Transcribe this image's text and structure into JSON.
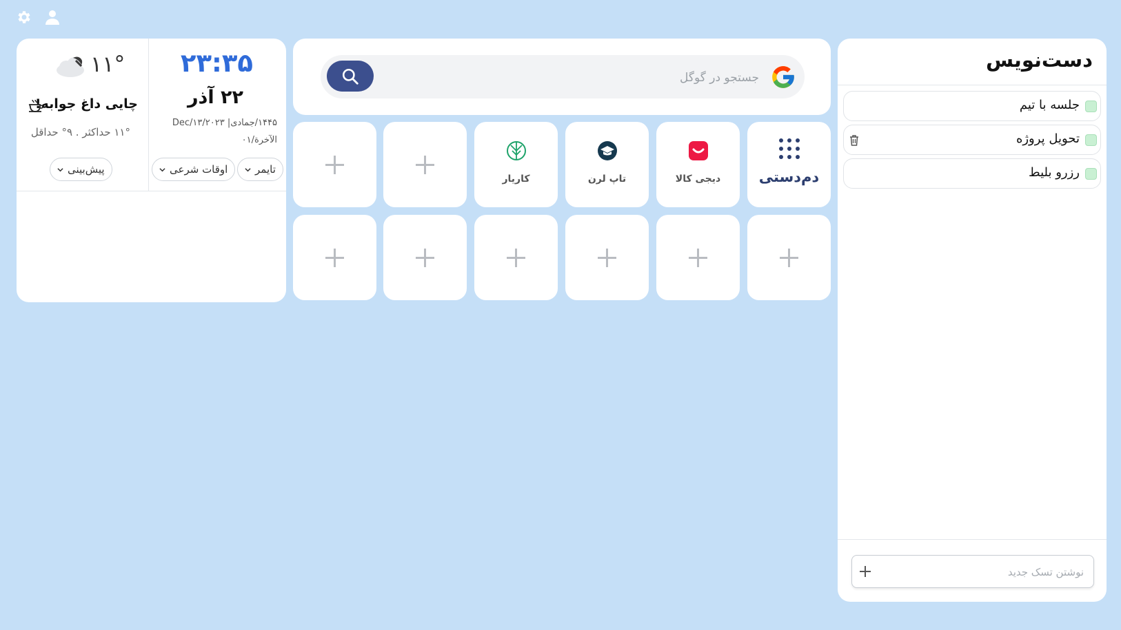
{
  "toolbar": {
    "settings_icon": "gear-icon",
    "profile_icon": "user-icon"
  },
  "info": {
    "clock": "۲۳:۳۵",
    "date_fa": "۲۲ آذر",
    "date_line1": "۱۴۴۵/جمادی| ۲۰۲۳/Dec/۱۳",
    "date_line2": "الآخرة/۰۱",
    "temperature": "۱۱°",
    "weather_icon": "cloud-moon-icon",
    "tea_message": "چایی داغ جوابه!",
    "tea_icon": "tea-cup-icon",
    "min_max": "۱۱° حداکثر . ۹° حداقل",
    "pills": {
      "timer": "تایمر",
      "prayer_times": "اوقات شرعی",
      "forecast": "پیش‌بینی"
    }
  },
  "search": {
    "placeholder": "جستجو در گوگل",
    "engine_icon": "google-icon",
    "button_icon": "search-icon"
  },
  "shortcuts": {
    "tiles": [
      {
        "label": "دم‌دستی",
        "icon": "grid-dots-icon"
      },
      {
        "label": "دیجی کالا",
        "icon": "digikala-icon"
      },
      {
        "label": "تاپ لرن",
        "icon": "toplearn-icon"
      },
      {
        "label": "کاریار",
        "icon": "karyar-icon"
      }
    ],
    "add_icon": "plus-icon"
  },
  "notes": {
    "title": "دست‌نویس",
    "tasks": [
      {
        "label": "جلسه با تیم"
      },
      {
        "label": "تحویل پروژه"
      },
      {
        "label": "رزرو بلیط"
      }
    ],
    "new_task_placeholder": "نوشتن تسک جدید"
  },
  "colors": {
    "background": "#c5dff7",
    "clock": "#2f6bd9",
    "search_button": "#3c4f8e",
    "digikala": "#ed1944",
    "toplearn": "#16394f",
    "karyar": "#1ea36a",
    "grid_dots": "#2c3e6f"
  }
}
